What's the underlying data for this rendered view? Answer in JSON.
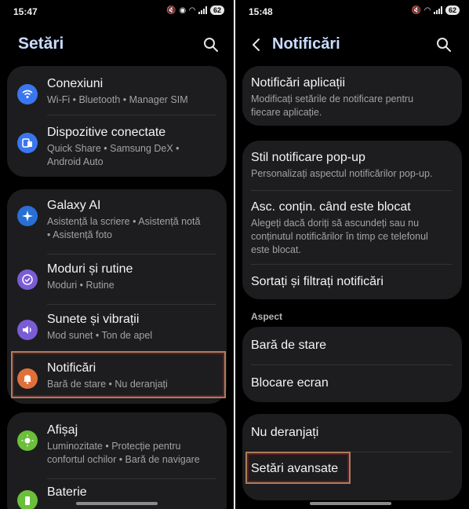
{
  "left": {
    "status": {
      "time": "15:47",
      "battery": "62"
    },
    "title": "Setări",
    "groups": [
      [
        {
          "id": "conexiuni",
          "title": "Conexiuni",
          "sub": [
            "Wi-Fi  •  Bluetooth  •  Manager SIM"
          ],
          "icon": "wifi-icon",
          "color": "#3a76f0"
        },
        {
          "id": "dispozitive",
          "title": "Dispozitive conectate",
          "sub": [
            "Quick Share  •  Samsung DeX  •",
            "Android Auto"
          ],
          "icon": "devices-icon",
          "color": "#3a76f0"
        }
      ],
      [
        {
          "id": "galaxy-ai",
          "title": "Galaxy AI",
          "sub": [
            "Asistență la scriere  •  Asistență notă",
            "•  Asistență foto"
          ],
          "icon": "sparkle-icon",
          "color": "#2a6fd6"
        },
        {
          "id": "moduri",
          "title": "Moduri și rutine",
          "sub": [
            "Moduri  •  Rutine"
          ],
          "icon": "check-circle-icon",
          "color": "#7b5cd6"
        },
        {
          "id": "sunete",
          "title": "Sunete și vibrații",
          "sub": [
            "Mod sunet  •  Ton de apel"
          ],
          "icon": "speaker-icon",
          "color": "#7b5cd6"
        },
        {
          "id": "notificari",
          "title": "Notificări",
          "sub": [
            "Bară de stare  •  Nu deranjați"
          ],
          "icon": "bell-icon",
          "color": "#e0703a"
        }
      ],
      [
        {
          "id": "afisaj",
          "title": "Afișaj",
          "sub": [
            "Luminozitate  •  Protecție pentru",
            "confortul ochilor  •  Bară de navigare"
          ],
          "icon": "sun-icon",
          "color": "#6bbf3a"
        },
        {
          "id": "baterie",
          "title": "Baterie",
          "sub": [],
          "icon": "battery-icon",
          "color": "#6bbf3a"
        }
      ]
    ]
  },
  "right": {
    "status": {
      "time": "15:48",
      "battery": "62"
    },
    "title": "Notificări",
    "groups": [
      [
        {
          "id": "notif-aplicatii",
          "title": "Notificări aplicații",
          "sub": [
            "Modificați setările de notificare pentru",
            "fiecare aplicație."
          ]
        }
      ],
      [
        {
          "id": "stil-popup",
          "title": "Stil notificare pop-up",
          "sub": [
            "Personalizați aspectul notificărilor pop-up."
          ]
        },
        {
          "id": "asc-contin",
          "title": "Asc. conțin. când este blocat",
          "sub": [
            "Alegeți dacă doriți să ascundeți sau nu",
            "conținutul notificărilor în timp ce telefonul",
            "este blocat."
          ]
        },
        {
          "id": "sortati",
          "title": "Sortați și filtrați notificări",
          "sub": []
        }
      ],
      [
        {
          "id": "bara-stare",
          "title": "Bară de stare",
          "sub": []
        },
        {
          "id": "blocare-ecran",
          "title": "Blocare ecran",
          "sub": []
        }
      ],
      [
        {
          "id": "nu-deranjati",
          "title": "Nu deranjați",
          "sub": []
        },
        {
          "id": "setari-avansate",
          "title": "Setări avansate",
          "sub": []
        }
      ]
    ],
    "section_label": "Aspect"
  }
}
